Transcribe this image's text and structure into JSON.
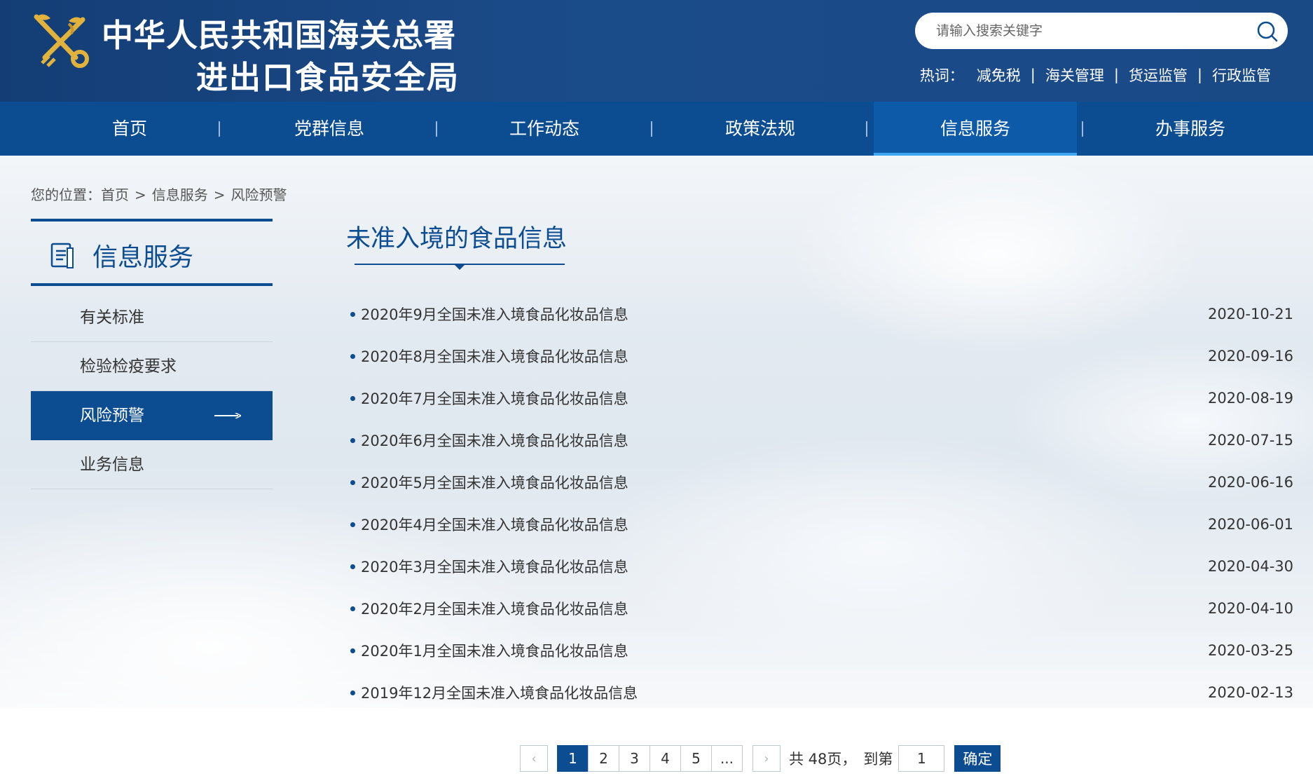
{
  "header": {
    "title_line1": "中华人民共和国海关总署",
    "title_line2": "进出口食品安全局",
    "search": {
      "placeholder": "请输入搜索关键字",
      "value": ""
    },
    "hot_label": "热词：",
    "hot_words": [
      "减免税",
      "海关管理",
      "货运监管",
      "行政监管"
    ],
    "hot_separator": "|"
  },
  "nav": {
    "items": [
      {
        "label": "首页"
      },
      {
        "label": "党群信息"
      },
      {
        "label": "工作动态"
      },
      {
        "label": "政策法规"
      },
      {
        "label": "信息服务",
        "active": true
      },
      {
        "label": "办事服务"
      }
    ],
    "separator": "|"
  },
  "breadcrumb": {
    "prefix": "您的位置：",
    "items": [
      "首页",
      "信息服务",
      "风险预警"
    ],
    "separator": ">"
  },
  "sidebar": {
    "title": "信息服务",
    "items": [
      {
        "label": "有关标准"
      },
      {
        "label": "检验检疫要求"
      },
      {
        "label": "风险预警",
        "active": true
      },
      {
        "label": "业务信息"
      }
    ]
  },
  "main": {
    "title": "未准入境的食品信息",
    "news": [
      {
        "title": "2020年9月全国未准入境食品化妆品信息",
        "date": "2020-10-21"
      },
      {
        "title": "2020年8月全国未准入境食品化妆品信息",
        "date": "2020-09-16"
      },
      {
        "title": "2020年7月全国未准入境食品化妆品信息",
        "date": "2020-08-19"
      },
      {
        "title": "2020年6月全国未准入境食品化妆品信息",
        "date": "2020-07-15"
      },
      {
        "title": "2020年5月全国未准入境食品化妆品信息",
        "date": "2020-06-16"
      },
      {
        "title": "2020年4月全国未准入境食品化妆品信息",
        "date": "2020-06-01"
      },
      {
        "title": "2020年3月全国未准入境食品化妆品信息",
        "date": "2020-04-30"
      },
      {
        "title": "2020年2月全国未准入境食品化妆品信息",
        "date": "2020-04-10"
      },
      {
        "title": "2020年1月全国未准入境食品化妆品信息",
        "date": "2020-03-25"
      },
      {
        "title": "2019年12月全国未准入境食品化妆品信息",
        "date": "2020-02-13"
      }
    ]
  },
  "pagination": {
    "prev": "‹",
    "next": "›",
    "pages": [
      "1",
      "2",
      "3",
      "4",
      "5",
      "..."
    ],
    "current": "1",
    "total_text": "共 48页，",
    "goto_label": "到第",
    "goto_value": "1",
    "confirm_label": "确定"
  },
  "colors": {
    "header_bg": "#1a4a86",
    "nav_bg": "#0c4c91",
    "accent": "#0c4c91",
    "nav_active_underline": "#3fa6f2",
    "emblem_gold": "#e2b33c"
  },
  "icons": {
    "emblem": "customs-emblem-icon",
    "search": "search-icon",
    "sidebar_header": "document-icon",
    "active_item": "arrow-right-icon",
    "list_bullet": "bullet-dot-icon"
  }
}
